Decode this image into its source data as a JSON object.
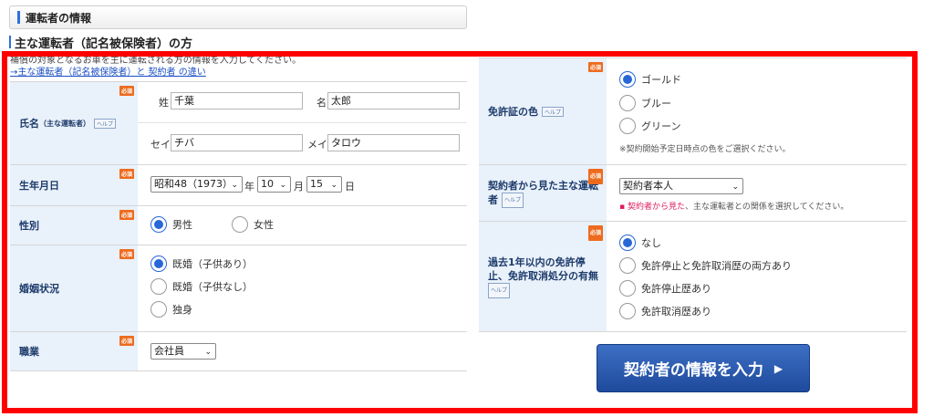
{
  "section": {
    "title": "運転者の情報"
  },
  "subheading": "主な運転者（記名被保険者）の方",
  "intro": {
    "note": "補償の対象となるお車を主に運転される方の情報を入力してください。",
    "link": "→主な運転者（記名被保険者）と 契約者 の違い"
  },
  "badges": {
    "required": "必須",
    "help": "ヘルプ"
  },
  "name": {
    "label": "氏名",
    "label_small": "（主な運転者）",
    "sei_label": "姓",
    "sei_value": "千葉",
    "mei_label": "名",
    "mei_value": "太郎",
    "sei_kana_label": "セイ",
    "sei_kana_value": "チバ",
    "mei_kana_label": "メイ",
    "mei_kana_value": "タロウ"
  },
  "birth": {
    "label": "生年月日",
    "year": "昭和48（1973）",
    "year_unit": "年",
    "month": "10",
    "month_unit": "月",
    "day": "15",
    "day_unit": "日"
  },
  "gender": {
    "label": "性別",
    "options": [
      "男性",
      "女性"
    ]
  },
  "marital": {
    "label": "婚姻状況",
    "options": [
      "既婚（子供あり）",
      "既婚（子供なし）",
      "独身"
    ]
  },
  "job": {
    "label": "職業",
    "value": "会社員"
  },
  "license_color": {
    "label": "免許証の色",
    "options": [
      "ゴールド",
      "ブルー",
      "グリーン"
    ],
    "hint": "※契約開始予定日時点の色をご選択ください。"
  },
  "relation": {
    "label_line1": "契約者から見た主な運転",
    "label_line2": "者",
    "value": "契約者本人",
    "hint_pink": "契約者から見た",
    "hint_rest": "、主な運転者との関係を選択してください。"
  },
  "suspension": {
    "label_line1": "過去1年以内の免許停",
    "label_line2": "止、免許取消処分の有無",
    "options": [
      "なし",
      "免許停止と免許取消歴の両方あり",
      "免許停止歴あり",
      "免許取消歴あり"
    ]
  },
  "submit": {
    "label": "契約者の情報を入力"
  },
  "colors": {
    "accent_blue": "#2867d6",
    "label_bg": "#e9f1fa",
    "required_orange": "#ee6b1e",
    "frame_red": "#ff0000"
  }
}
